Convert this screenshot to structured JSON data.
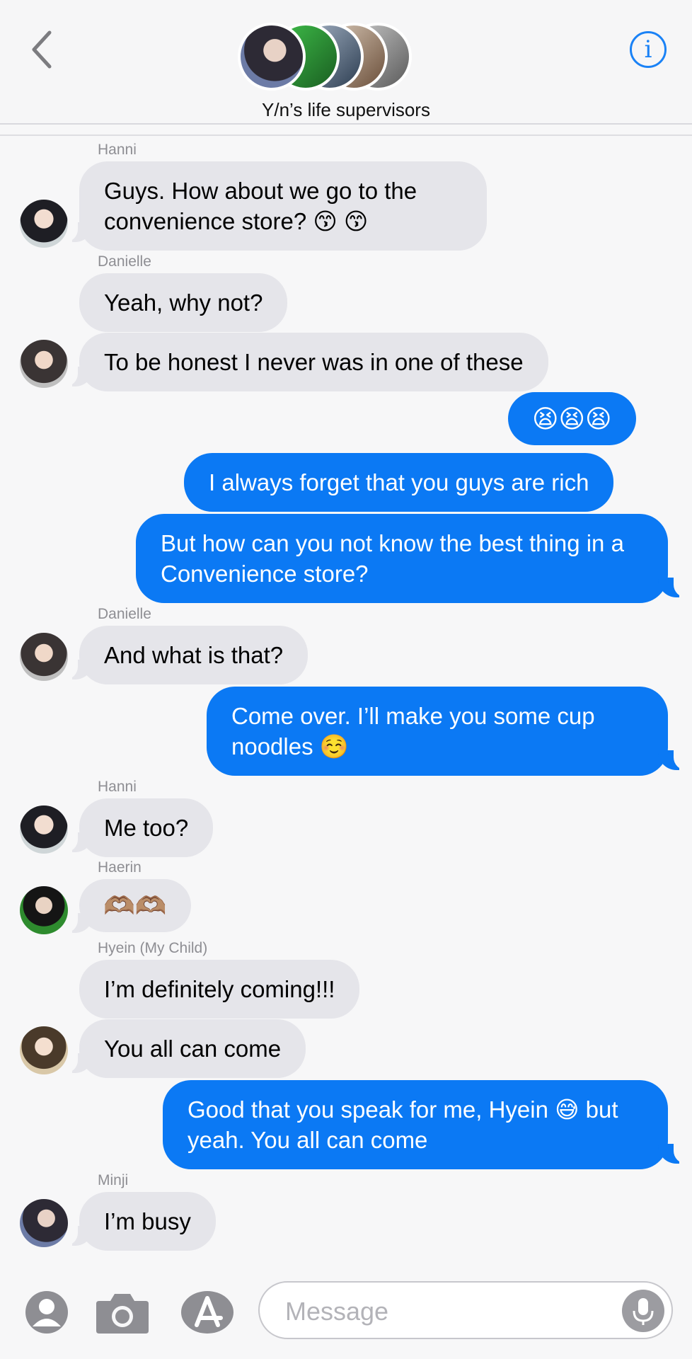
{
  "header": {
    "group_name": "Y/n’s life supervisors"
  },
  "messages": [
    {
      "sender": "Hanni",
      "text": "Guys. How about we go to the convenience store? 😙 😙"
    },
    {
      "sender": "Danielle",
      "text": "Yeah, why not?"
    },
    {
      "sender": "Danielle",
      "text": "To be honest I never was in one of these"
    },
    {
      "sender": "me",
      "text": "😫😫😫"
    },
    {
      "sender": "me",
      "text": "I always forget that you guys are rich"
    },
    {
      "sender": "me",
      "text": "But how can you not know the best thing in a Convenience store?"
    },
    {
      "sender": "Danielle",
      "text": "And what is that?"
    },
    {
      "sender": "me",
      "text": "Come over. I’ll make you some cup noodles ☺️"
    },
    {
      "sender": "Hanni",
      "text": "Me too?"
    },
    {
      "sender": "Haerin",
      "text": "🫶🏽🫶🏽"
    },
    {
      "sender": "Hyein (My Child)",
      "text": "I’m definitely coming!!!"
    },
    {
      "sender": "Hyein (My Child)",
      "text": "You all can come"
    },
    {
      "sender": "me",
      "text": "Good that you speak for me, Hyein 😅 but yeah. You all can come"
    },
    {
      "sender": "Minji",
      "text": "I’m busy"
    }
  ],
  "input": {
    "placeholder": "Message"
  },
  "icons": {
    "back": "chevron-left-icon",
    "info": "info-icon",
    "contact": "person-icon",
    "camera": "camera-icon",
    "apps": "app-store-icon",
    "mic": "microphone-icon"
  },
  "colors": {
    "accent": "#1a82f6",
    "outgoing_bubble": "#0b79f4",
    "incoming_bubble": "#e5e5ea"
  }
}
